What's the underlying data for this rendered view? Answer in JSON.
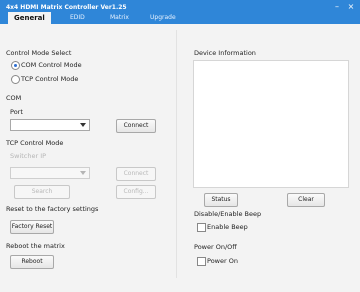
{
  "window": {
    "title": "4x4 HDMI Matrix Controller Ver1.25",
    "min_glyph": "–",
    "close_glyph": "×"
  },
  "tabs": [
    {
      "label": "General",
      "active": true
    },
    {
      "label": "EDID",
      "active": false
    },
    {
      "label": "Matrix",
      "active": false
    },
    {
      "label": "Upgrade",
      "active": false
    }
  ],
  "left": {
    "control_mode_select": "Control Mode Select",
    "com_control_mode": "COM Control Mode",
    "tcp_control_mode": "TCP Control Mode",
    "com_section": "COM",
    "port_label": "Port",
    "port_value": "",
    "connect_button": "Connect",
    "tcp_section": "TCP Control Mode",
    "switcher_ip_label": "Switcher IP",
    "switcher_ip_value": "",
    "tcp_connect_button": "Connect",
    "search_button": "Search",
    "config_button": "Config...",
    "reset_section": "Reset to the factory settings",
    "factory_reset_button": "Factory Reset",
    "reboot_section": "Reboot the matrix",
    "reboot_button": "Reboot"
  },
  "right": {
    "device_info_label": "Device Information",
    "status_button": "Status",
    "clear_button": "Clear",
    "beep_section": "Disable/Enable Beep",
    "enable_beep_label": "Enable Beep",
    "power_section": "Power On/Off",
    "power_on_label": "Power On"
  },
  "state": {
    "com_selected": true,
    "enable_beep": false,
    "power_on": false
  }
}
